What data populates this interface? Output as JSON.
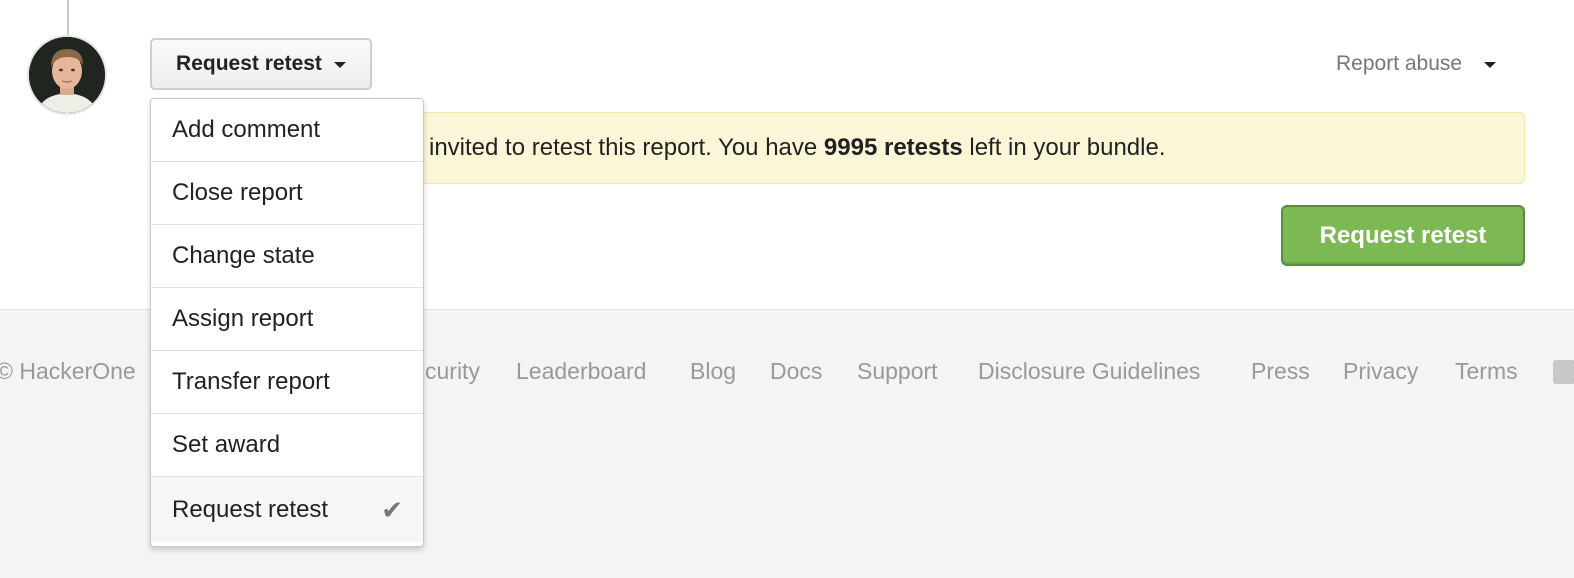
{
  "actions": {
    "dropdown_label": "Request retest",
    "menu_items": [
      {
        "label": "Add comment",
        "selected": false
      },
      {
        "label": "Close report",
        "selected": false
      },
      {
        "label": "Change state",
        "selected": false
      },
      {
        "label": "Assign report",
        "selected": false
      },
      {
        "label": "Transfer report",
        "selected": false
      },
      {
        "label": "Set award",
        "selected": false
      },
      {
        "label": "Request retest",
        "selected": true
      }
    ],
    "selected_icon": "✔"
  },
  "report_abuse": {
    "label": "Report abuse"
  },
  "notice": {
    "text_before": "invited to retest this report. You have ",
    "retests_count": "9995 retests",
    "text_after": " left in your bundle."
  },
  "primary_button": {
    "label": "Request retest",
    "color": "#7cb955"
  },
  "footer": {
    "copyright": "© HackerOne",
    "links": [
      "curity",
      "Leaderboard",
      "Blog",
      "Docs",
      "Support",
      "Disclosure Guidelines",
      "Press",
      "Privacy",
      "Terms"
    ],
    "social_icon": "twitter-icon"
  },
  "colors": {
    "notice_bg": "#fcf6d8",
    "footer_bg": "#f4f4f4",
    "footer_text": "#999999"
  }
}
